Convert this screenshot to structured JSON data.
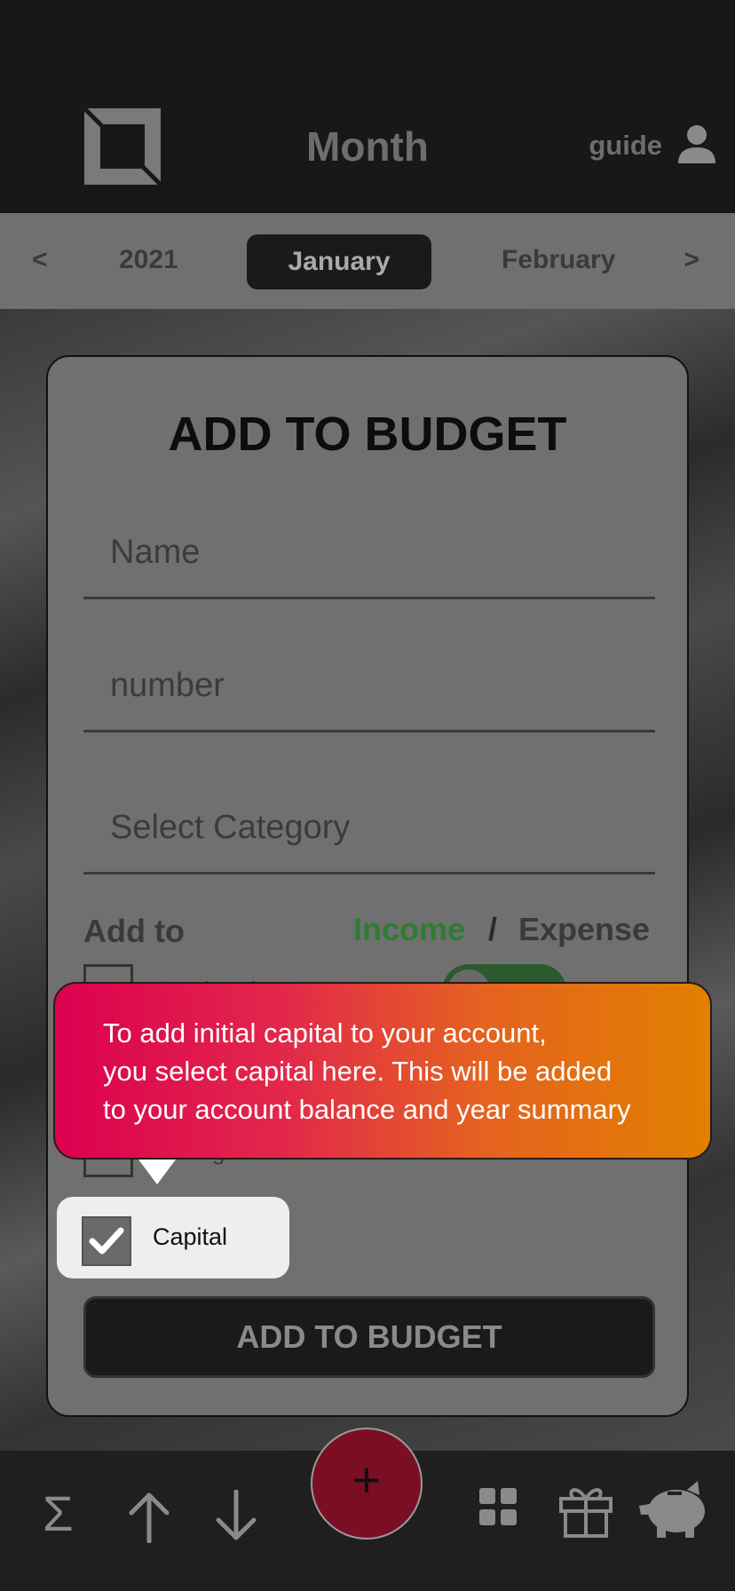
{
  "header": {
    "title": "Month",
    "guide_label": "guide"
  },
  "months": {
    "prev": "<",
    "year": "2021",
    "active": "January",
    "next_month": "February",
    "next": ">"
  },
  "modal": {
    "title": "ADD TO BUDGET",
    "name_placeholder": "Name",
    "number_placeholder": "number",
    "category_placeholder": "Select Category",
    "add_to_label": "Add to",
    "income_label": "Income",
    "slash": "/",
    "expense_label": "Expense",
    "option_overhead": "Overhead",
    "option_savings": "Savings",
    "option_capital": "Capital",
    "submit_label": "ADD TO BUDGET"
  },
  "tooltip": {
    "line1": "To add initial capital to your account,",
    "line2": "you select capital here. This will be added",
    "line3": "to your account balance and year summary"
  },
  "fab": {
    "symbol": "+"
  },
  "bottom_nav": {
    "sigma": "Σ"
  },
  "colors": {
    "income": "#2e7d32",
    "fab": "#7a0f24",
    "tooltip_start": "#dc0050",
    "tooltip_end": "#e28000"
  },
  "icons": [
    "app-logo-icon",
    "user-icon",
    "sigma-icon",
    "arrow-up-icon",
    "arrow-down-icon",
    "plus-icon",
    "grid-icon",
    "gift-icon",
    "piggy-bank-icon",
    "checkmark-icon"
  ]
}
